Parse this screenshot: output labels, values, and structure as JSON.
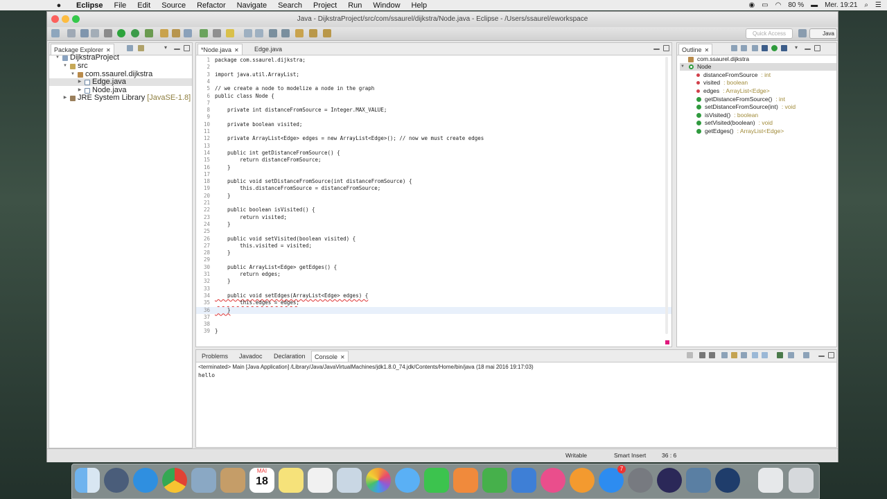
{
  "menubar": {
    "items": [
      "Eclipse",
      "File",
      "Edit",
      "Source",
      "Refactor",
      "Navigate",
      "Search",
      "Project",
      "Run",
      "Window",
      "Help"
    ],
    "battery": "80 %",
    "clock": "Mer. 19:21"
  },
  "window": {
    "title": "Java - DijkstraProject/src/com/ssaurel/dijkstra/Node.java - Eclipse - /Users/ssaurel/eworkspace",
    "quick_access_placeholder": "Quick Access",
    "perspective": "Java"
  },
  "package_explorer": {
    "tab": "Package Explorer",
    "tree": [
      "DijkstraProject",
      "src",
      "com.ssaurel.dijkstra",
      "Edge.java",
      "Node.java",
      "JRE System Library"
    ],
    "jre_suffix": "[JavaSE-1.8]"
  },
  "editor": {
    "tabs": [
      "*Node.java",
      "Edge.java"
    ],
    "lines": [
      "package com.ssaurel.dijkstra;",
      "",
      "import java.util.ArrayList;",
      "",
      "// we create a node to modelize a node in the graph",
      "public class Node {",
      "",
      "    private int distanceFromSource = Integer.MAX_VALUE;",
      "",
      "    private boolean visited;",
      "",
      "    private ArrayList<Edge> edges = new ArrayList<Edge>(); // now we must create edges",
      "",
      "    public int getDistanceFromSource() {",
      "        return distanceFromSource;",
      "    }",
      "",
      "    public void setDistanceFromSource(int distanceFromSource) {",
      "        this.distanceFromSource = distanceFromSource;",
      "    }",
      "",
      "    public boolean isVisited() {",
      "        return visited;",
      "    }",
      "",
      "    public void setVisited(boolean visited) {",
      "        this.visited = visited;",
      "    }",
      "",
      "    public ArrayList<Edge> getEdges() {",
      "        return edges;",
      "    }",
      "",
      "    public void setEdges(ArrayList<Edge> edges) {",
      "        this.edges = edges;",
      "    }",
      "",
      "",
      "}"
    ]
  },
  "outline": {
    "tab": "Outline",
    "package": "com.ssaurel.dijkstra",
    "class": "Node",
    "members": [
      {
        "name": "distanceFromSource",
        "type": " : int"
      },
      {
        "name": "visited",
        "type": " : boolean"
      },
      {
        "name": "edges",
        "type": " : ArrayList<Edge>"
      },
      {
        "name": "getDistanceFromSource()",
        "type": " : int"
      },
      {
        "name": "setDistanceFromSource(int)",
        "type": " : void"
      },
      {
        "name": "isVisited()",
        "type": " : boolean"
      },
      {
        "name": "setVisited(boolean)",
        "type": " : void"
      },
      {
        "name": "getEdges()",
        "type": " : ArrayList<Edge>"
      }
    ]
  },
  "console": {
    "tabs": [
      "Problems",
      "Javadoc",
      "Declaration",
      "Console"
    ],
    "terminated": "<terminated> Main [Java Application] /Library/Java/JavaVirtualMachines/jdk1.8.0_74.jdk/Contents/Home/bin/java (18 mai 2016 19:17:03)",
    "output": "hello"
  },
  "status": {
    "writable": "Writable",
    "insert_mode": "Smart Insert",
    "position": "36 : 6"
  },
  "dock": {
    "calendar_month": "MAI",
    "calendar_day": "18",
    "appstore_badge": "7"
  }
}
